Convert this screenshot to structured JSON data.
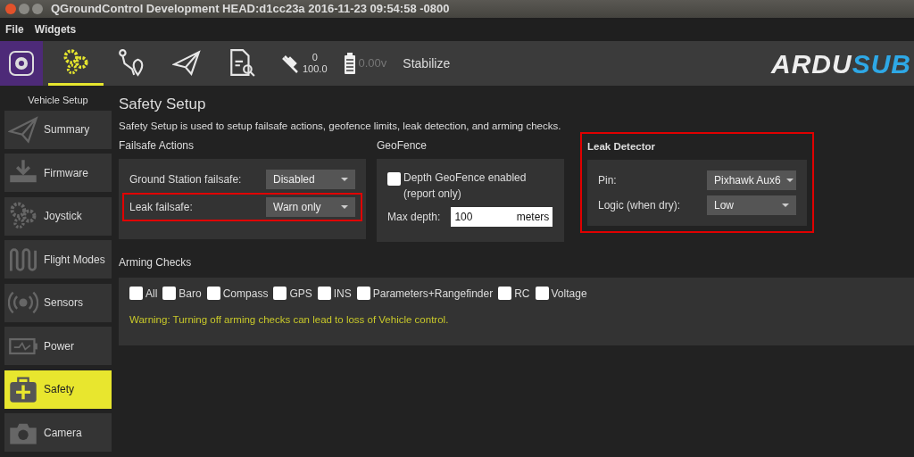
{
  "window": {
    "title": "QGroundControl Development HEAD:d1cc23a 2016-11-23 09:54:58 -0800"
  },
  "menu": [
    "File",
    "Widgets"
  ],
  "toolbar": {
    "tools": [
      {
        "kind": "gears",
        "selected": true
      },
      {
        "kind": "route",
        "selected": false
      },
      {
        "kind": "plane",
        "selected": false
      },
      {
        "kind": "log",
        "selected": false
      }
    ],
    "satellite": {
      "count": "0",
      "hdop": "100.0"
    },
    "battery": {
      "reading": "0.00v",
      "disabled": true
    },
    "flight_mode": "Stabilize",
    "logo": {
      "part_1": "ARDU",
      "part_2": "SUB"
    }
  },
  "sidebar": {
    "title": "Vehicle Setup",
    "items": [
      {
        "label": "Summary",
        "kind": "plane",
        "selected": false
      },
      {
        "label": "Firmware",
        "kind": "download",
        "selected": false
      },
      {
        "label": "Joystick",
        "kind": "gears",
        "selected": false
      },
      {
        "label": "Flight Modes",
        "kind": "wave",
        "selected": false
      },
      {
        "label": "Sensors",
        "kind": "radio",
        "selected": false
      },
      {
        "label": "Power",
        "kind": "battery",
        "selected": false
      },
      {
        "label": "Safety",
        "kind": "medkit",
        "selected": true
      },
      {
        "label": "Camera",
        "kind": "camera",
        "selected": false
      }
    ]
  },
  "page": {
    "title": "Safety Setup",
    "description": "Safety Setup is used to setup failsafe actions, geofence limits, leak detection, and arming checks."
  },
  "failsafe": {
    "heading": "Failsafe Actions",
    "rows": [
      {
        "label": "Ground Station failsafe:",
        "value": "Disabled",
        "highlighted": false
      },
      {
        "label": "Leak failsafe:",
        "value": "Warn only",
        "highlighted": true
      }
    ]
  },
  "geofence": {
    "heading": "GeoFence",
    "checkbox": {
      "label": "Depth GeoFence enabled (report only)",
      "checked": false
    },
    "max_depth": {
      "label": "Max depth:",
      "value": "100",
      "unit": "meters"
    }
  },
  "leak_detector": {
    "heading": "Leak Detector",
    "highlighted": true,
    "rows": [
      {
        "label": "Pin:",
        "value": "Pixhawk Aux6"
      },
      {
        "label": "Logic (when dry):",
        "value": "Low"
      }
    ]
  },
  "arming_checks": {
    "heading": "Arming Checks",
    "checks": [
      {
        "label": "All",
        "checked": false
      },
      {
        "label": "Baro",
        "checked": false
      },
      {
        "label": "Compass",
        "checked": false
      },
      {
        "label": "GPS",
        "checked": false
      },
      {
        "label": "INS",
        "checked": false
      },
      {
        "label": "Parameters+Rangefinder",
        "checked": false
      },
      {
        "label": "RC",
        "checked": false
      },
      {
        "label": "Voltage",
        "checked": false
      }
    ],
    "warning": "Warning: Turning off arming checks can lead to loss of Vehicle control."
  }
}
